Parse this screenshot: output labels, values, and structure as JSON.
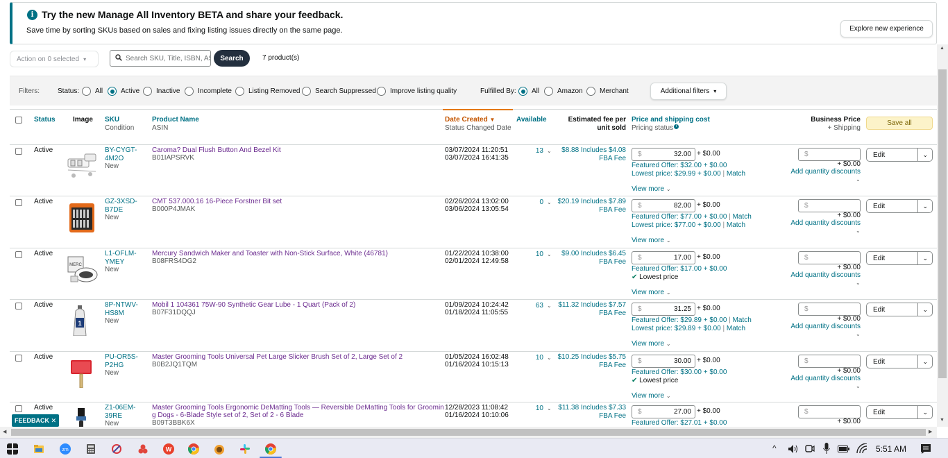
{
  "banner": {
    "title": "Try the new Manage All Inventory BETA and share your feedback.",
    "subtitle": "Save time by sorting SKUs based on sales and fixing listing issues directly on the same page.",
    "explore_label": "Explore new experience"
  },
  "toolbar": {
    "action_label": "Action on 0 selected",
    "search_placeholder": "Search SKU, Title, ISBN, ASIN",
    "search_button": "Search",
    "product_count": "7 product(s)"
  },
  "filters": {
    "label": "Filters:",
    "status_label": "Status:",
    "status_options": [
      "All",
      "Active",
      "Inactive",
      "Incomplete",
      "Listing Removed",
      "Search Suppressed",
      "Improve listing quality"
    ],
    "status_selected": "Active",
    "fulfilled_label": "Fulfilled By:",
    "fulfilled_options": [
      "All",
      "Amazon",
      "Merchant"
    ],
    "fulfilled_selected": "All",
    "additional_label": "Additional filters"
  },
  "table": {
    "headers": {
      "status": "Status",
      "image": "Image",
      "sku": "SKU",
      "condition": "Condition",
      "product_name": "Product Name",
      "asin": "ASIN",
      "date_created": "Date Created",
      "status_changed": "Status Changed Date",
      "available": "Available",
      "fee_line1": "Estimated fee per",
      "fee_line2": "unit sold",
      "price": "Price and shipping cost",
      "pricing_status": "Pricing status",
      "business_price": "Business Price",
      "plus_shipping": "+ Shipping",
      "save_all": "Save all"
    },
    "common": {
      "shipping_zero": "+ $0.00",
      "currency": "$",
      "view_more": "View more",
      "add_qty": "Add quantity discounts",
      "edit": "Edit",
      "fba_fee": "FBA Fee",
      "match": "Match",
      "lowest_price_badge": "Lowest price"
    },
    "rows": [
      {
        "status": "Active",
        "sku1": "BY-CYGT-",
        "sku2": "4M2O",
        "condition": "New",
        "name": "Caroma? Dual Flush Button And Bezel Kit",
        "asin": "B01IAPSRVK",
        "created": "03/07/2024 11:20:51",
        "changed": "03/07/2024 16:41:35",
        "available": "13",
        "fee": "$8.88 Includes $4.08",
        "price": "32.00",
        "featured": "Featured Offer: $32.00 + $0.00",
        "featured_match": false,
        "lowest": "Lowest price: $29.99 + $0.00",
        "lowest_match": true,
        "is_lowest": false,
        "img": "kit"
      },
      {
        "status": "Active",
        "sku1": "GZ-3XSD-",
        "sku2": "B7DE",
        "condition": "New",
        "name": "CMT 537.000.16 16-Piece Forstner Bit set",
        "asin": "B000P4JMAK",
        "created": "02/26/2024 13:02:00",
        "changed": "03/06/2024 13:05:54",
        "available": "0",
        "fee": "$20.19 Includes $7.89",
        "price": "82.00",
        "featured": "Featured Offer: $77.00 + $0.00",
        "featured_match": true,
        "lowest": "Lowest price: $77.00 + $0.00",
        "lowest_match": true,
        "is_lowest": false,
        "img": "case"
      },
      {
        "status": "Active",
        "sku1": "L1-OFLM-",
        "sku2": "YMEY",
        "condition": "New",
        "name": "Mercury Sandwich Maker and Toaster with Non-Stick Surface, White (46781)",
        "asin": "B08FRS4DG2",
        "created": "01/22/2024 10:38:00",
        "changed": "02/01/2024 12:49:58",
        "available": "10",
        "fee": "$9.00 Includes $6.45",
        "price": "17.00",
        "featured": "Featured Offer: $17.00 + $0.00",
        "featured_match": false,
        "lowest": "",
        "lowest_match": false,
        "is_lowest": true,
        "img": "maker"
      },
      {
        "status": "Active",
        "sku1": "8P-NTWV-",
        "sku2": "HS8M",
        "condition": "New",
        "name": "Mobil 1 104361 75W-90 Synthetic Gear Lube - 1 Quart (Pack of 2)",
        "asin": "B07F31DQQJ",
        "created": "01/09/2024 10:24:42",
        "changed": "01/18/2024 11:05:55",
        "available": "63",
        "fee": "$11.32 Includes $7.57",
        "price": "31.25",
        "featured": "Featured Offer: $29.89 + $0.00",
        "featured_match": true,
        "lowest": "Lowest price: $29.89 + $0.00",
        "lowest_match": true,
        "is_lowest": false,
        "img": "bottle"
      },
      {
        "status": "Active",
        "sku1": "PU-OR5S-",
        "sku2": "P2HG",
        "condition": "New",
        "name": "Master Grooming Tools Universal Pet Large Slicker Brush Set of 2, Large Set of 2",
        "asin": "B0B2JQ1TQM",
        "created": "01/05/2024 16:02:48",
        "changed": "01/16/2024 10:15:13",
        "available": "10",
        "fee": "$10.25 Includes $5.75",
        "price": "30.00",
        "featured": "Featured Offer: $30.00 + $0.00",
        "featured_match": false,
        "lowest": "",
        "lowest_match": false,
        "is_lowest": true,
        "img": "brush"
      },
      {
        "status": "Active",
        "sku1": "Z1-06EM-",
        "sku2": "39RE",
        "condition": "New",
        "name": "Master Grooming Tools Ergonomic DeMatting Tools — Reversible DeMatting Tools for Groomin",
        "name2": "g Dogs - 6-Blade Style set of 2, Set of 2 - 6 Blade",
        "asin": "B09T3BBK6X",
        "created": "12/28/2023 11:08:42",
        "changed": "01/16/2024 10:10:06",
        "available": "10",
        "fee": "$11.38 Includes $7.33",
        "price": "27.00",
        "featured": "Featured Offer: $27.01 + $0.00",
        "featured_match": false,
        "lowest": "",
        "lowest_match": false,
        "is_lowest": false,
        "img": "tool"
      }
    ]
  },
  "feedback_label": "FEEDBACK ✕",
  "taskbar": {
    "time": "5:51 AM",
    "apps": [
      "start",
      "file-explorer",
      "zoom",
      "calculator",
      "snipping",
      "app-red",
      "wps",
      "chrome",
      "app-orange",
      "slack",
      "chrome-profile"
    ]
  }
}
